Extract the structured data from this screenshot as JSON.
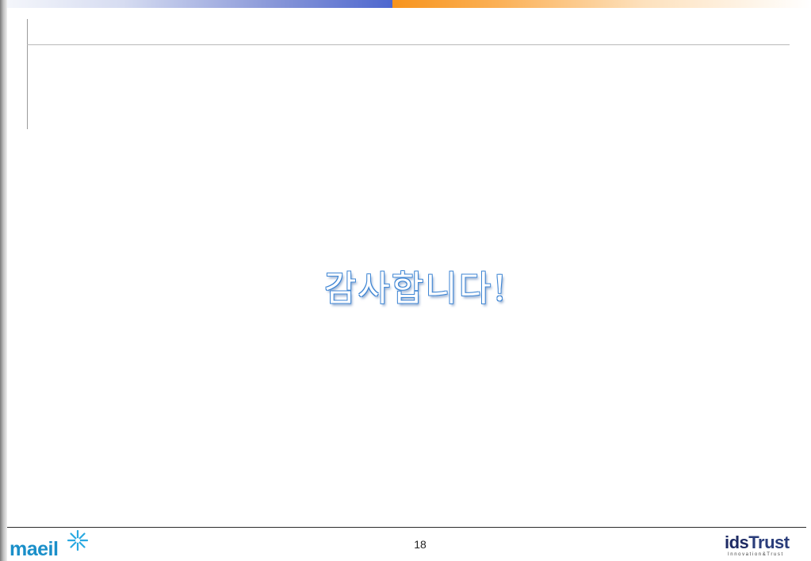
{
  "slide": {
    "message": "감사합니다!",
    "page_number": "18"
  },
  "logos": {
    "left": {
      "text": "maeil",
      "icon": "sparkle-icon"
    },
    "right": {
      "text_ids": "ids",
      "text_trust": "Trust",
      "tagline": "Innovation&Trust"
    }
  },
  "colors": {
    "message_outline": "#3f86d4",
    "top_bar_blue": "#4e67cf",
    "top_bar_orange": "#f7941d",
    "maeil_blue": "#1a8fc9",
    "idstrust_navy": "#1e2b64"
  }
}
